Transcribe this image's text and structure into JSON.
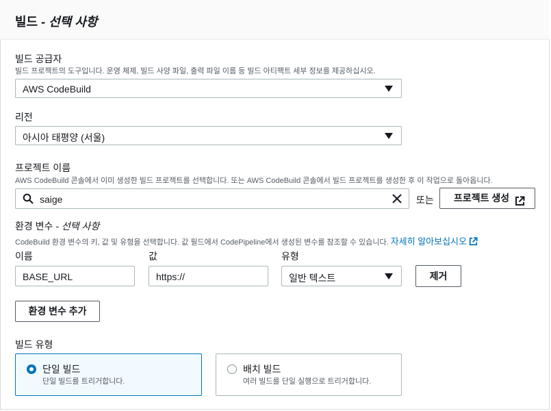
{
  "section": {
    "title": "빌드",
    "title_optional": " - 선택 사항"
  },
  "build_provider": {
    "label": "빌드 공급자",
    "description": "빌드 프로젝트의 도구입니다. 운영 체제, 빌드 사양 파일, 출력 파일 이름 등 빌드 아티팩트 세부 정보를 제공하십시오.",
    "selected": "AWS CodeBuild"
  },
  "region": {
    "label": "리전",
    "selected": "아시아 태평양 (서울)"
  },
  "project_name": {
    "label": "프로젝트 이름",
    "description": "AWS CodeBuild 콘솔에서 이미 생성한 빌드 프로젝트를 선택합니다. 또는 AWS CodeBuild 콘솔에서 빌드 프로젝트를 생성한 후 이 작업으로 돌아옵니다.",
    "search_value": "saige",
    "or_text": "또는",
    "create_label": "프로젝트 생성"
  },
  "env_vars": {
    "label": "환경 변수",
    "label_optional": " - 선택 사항",
    "description": "CodeBuild 환경 변수의 키, 값 및 유형을 선택합니다. 값 필드에서 CodePipeline에서 생성된 변수를 참조할 수 있습니다.",
    "learn_more": "자세히 알아보십시오",
    "col_name": "이름",
    "col_value": "값",
    "col_type": "유형",
    "name_value": "BASE_URL",
    "value_value": "https://",
    "type_value": "일반 텍스트",
    "remove_label": "제거",
    "add_label": "환경 변수 추가"
  },
  "build_type": {
    "label": "빌드 유형",
    "options": [
      {
        "title": "단일 빌드",
        "description": "단일 빌드를 트리거합니다.",
        "selected": true
      },
      {
        "title": "배치 빌드",
        "description": "여러 빌드를 단일 실행으로 트리거합니다.",
        "selected": false
      }
    ]
  },
  "icons": {
    "search": "search-icon",
    "clear": "close-icon",
    "external": "external-link-icon",
    "caret": "caret-down-icon"
  },
  "colors": {
    "accent": "#0073bb",
    "border": "#aab7b8",
    "text": "#16191f",
    "muted": "#545b64"
  }
}
